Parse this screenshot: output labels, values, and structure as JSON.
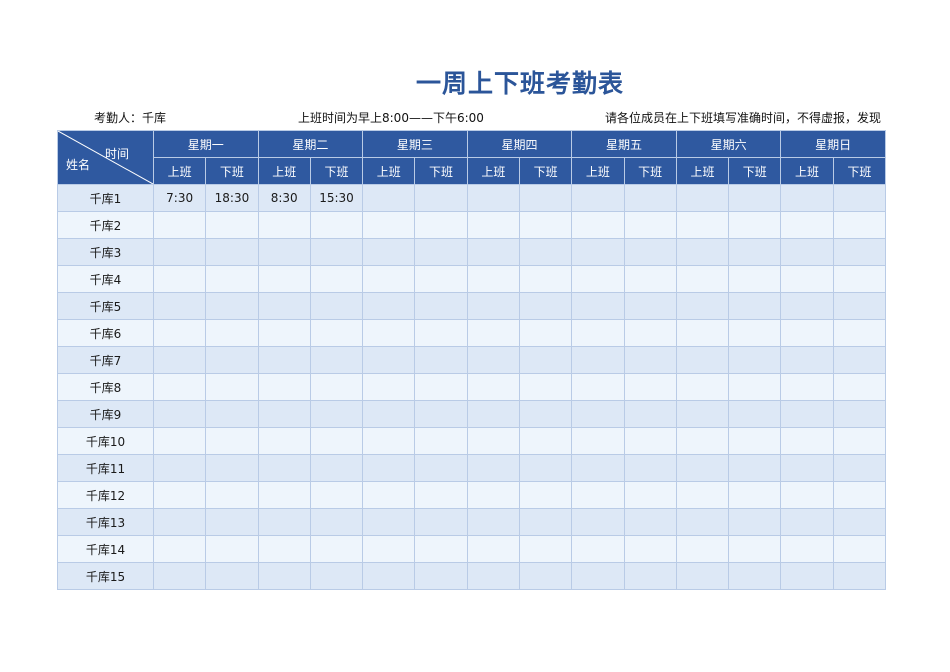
{
  "title": "一周上下班考勤表",
  "meta": {
    "checker": "考勤人：千库",
    "hours": "上班时间为早上8:00——下午6:00",
    "note": "请各位成员在上下班填写准确时间，不得虚报，发现"
  },
  "header": {
    "corner_time": "时间",
    "corner_name": "姓名",
    "days": [
      "星期一",
      "星期二",
      "星期三",
      "星期四",
      "星期五",
      "星期六",
      "星期日"
    ],
    "on_label": "上班",
    "off_label": "下班"
  },
  "rows": [
    {
      "name": "千库1",
      "times": [
        "7:30",
        "18:30",
        "8:30",
        "15:30",
        "",
        "",
        "",
        "",
        "",
        "",
        "",
        "",
        "",
        ""
      ]
    },
    {
      "name": "千库2",
      "times": [
        "",
        "",
        "",
        "",
        "",
        "",
        "",
        "",
        "",
        "",
        "",
        "",
        "",
        ""
      ]
    },
    {
      "name": "千库3",
      "times": [
        "",
        "",
        "",
        "",
        "",
        "",
        "",
        "",
        "",
        "",
        "",
        "",
        "",
        ""
      ]
    },
    {
      "name": "千库4",
      "times": [
        "",
        "",
        "",
        "",
        "",
        "",
        "",
        "",
        "",
        "",
        "",
        "",
        "",
        ""
      ]
    },
    {
      "name": "千库5",
      "times": [
        "",
        "",
        "",
        "",
        "",
        "",
        "",
        "",
        "",
        "",
        "",
        "",
        "",
        ""
      ]
    },
    {
      "name": "千库6",
      "times": [
        "",
        "",
        "",
        "",
        "",
        "",
        "",
        "",
        "",
        "",
        "",
        "",
        "",
        ""
      ]
    },
    {
      "name": "千库7",
      "times": [
        "",
        "",
        "",
        "",
        "",
        "",
        "",
        "",
        "",
        "",
        "",
        "",
        "",
        ""
      ]
    },
    {
      "name": "千库8",
      "times": [
        "",
        "",
        "",
        "",
        "",
        "",
        "",
        "",
        "",
        "",
        "",
        "",
        "",
        ""
      ]
    },
    {
      "name": "千库9",
      "times": [
        "",
        "",
        "",
        "",
        "",
        "",
        "",
        "",
        "",
        "",
        "",
        "",
        "",
        ""
      ]
    },
    {
      "name": "千库10",
      "times": [
        "",
        "",
        "",
        "",
        "",
        "",
        "",
        "",
        "",
        "",
        "",
        "",
        "",
        ""
      ]
    },
    {
      "name": "千库11",
      "times": [
        "",
        "",
        "",
        "",
        "",
        "",
        "",
        "",
        "",
        "",
        "",
        "",
        "",
        ""
      ]
    },
    {
      "name": "千库12",
      "times": [
        "",
        "",
        "",
        "",
        "",
        "",
        "",
        "",
        "",
        "",
        "",
        "",
        "",
        ""
      ]
    },
    {
      "name": "千库13",
      "times": [
        "",
        "",
        "",
        "",
        "",
        "",
        "",
        "",
        "",
        "",
        "",
        "",
        "",
        ""
      ]
    },
    {
      "name": "千库14",
      "times": [
        "",
        "",
        "",
        "",
        "",
        "",
        "",
        "",
        "",
        "",
        "",
        "",
        "",
        ""
      ]
    },
    {
      "name": "千库15",
      "times": [
        "",
        "",
        "",
        "",
        "",
        "",
        "",
        "",
        "",
        "",
        "",
        "",
        "",
        ""
      ]
    }
  ]
}
